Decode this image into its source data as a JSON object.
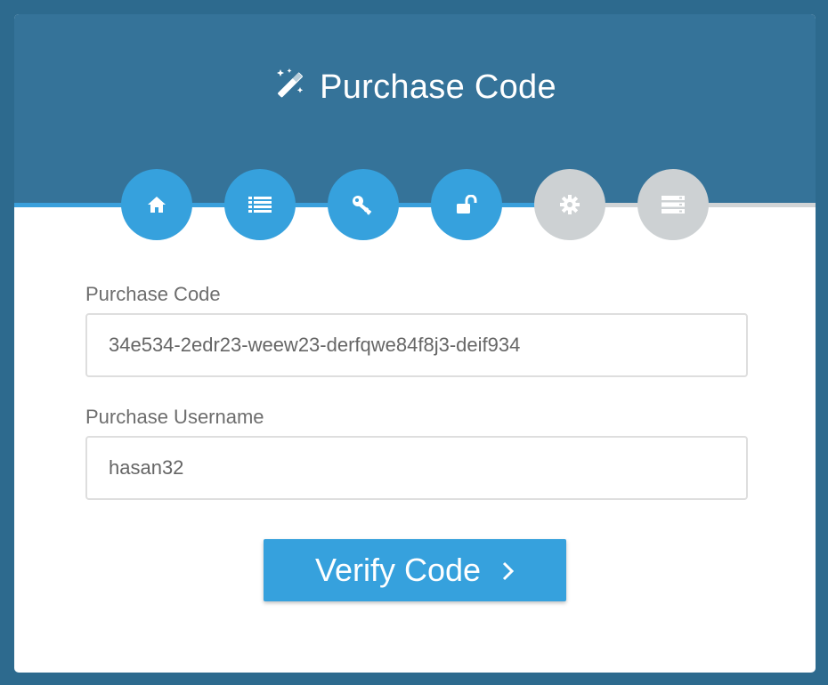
{
  "header": {
    "title": "Purchase Code",
    "title_icon": "magic-wand-icon"
  },
  "colors": {
    "background": "#2d6a8e",
    "header": "#357399",
    "accent": "#36a1dd",
    "inactive": "#cdd1d3"
  },
  "steps": [
    {
      "icon": "home-icon",
      "state": "complete"
    },
    {
      "icon": "list-icon",
      "state": "complete"
    },
    {
      "icon": "key-icon",
      "state": "complete"
    },
    {
      "icon": "unlock-icon",
      "state": "complete"
    },
    {
      "icon": "gear-icon",
      "state": "pending"
    },
    {
      "icon": "server-icon",
      "state": "pending"
    }
  ],
  "form": {
    "purchase_code_label": "Purchase Code",
    "purchase_code_value": "34e534-2edr23-weew23-derfqwe84f8j3-deif934",
    "purchase_username_label": "Purchase Username",
    "purchase_username_value": "hasan32",
    "verify_label": "Verify Code",
    "verify_icon": "chevron-right-icon"
  }
}
